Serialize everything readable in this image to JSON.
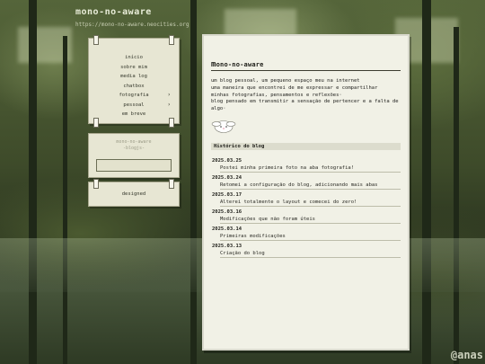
{
  "header": {
    "site_title": "mono-no-aware",
    "site_url": "https://mono-no-aware.neocities.org"
  },
  "watermark": "@anas",
  "sidebar": {
    "nav": [
      {
        "label": "início",
        "submenu": false
      },
      {
        "label": "sobre mim",
        "submenu": false
      },
      {
        "label": "media log",
        "submenu": false
      },
      {
        "label": "chatbox",
        "submenu": false
      },
      {
        "label": "fotografia",
        "submenu": true
      },
      {
        "label": "pessoal",
        "submenu": true
      },
      {
        "label": "em breve",
        "submenu": false
      }
    ],
    "blinkie_line1": "mono-no-aware",
    "blinkie_line2": "-blogjs-",
    "designed_label": "designed"
  },
  "main": {
    "title_initial": "m",
    "title_rest": "ono-no-aware",
    "intro_lines": [
      "um blog pessoal, um pequeno espaço meu na internet",
      "uma maneira que encontrei de me expressar e compartilhar",
      "minhas fotografias, pensamentos e reflexões·",
      "blog pensado em transmitir a sensação de pertencer e a falta de",
      "algo·"
    ],
    "history_title": "Histórico do blog",
    "history": [
      {
        "date": "2025.03.25",
        "text": "Postei minha primeira foto na aba fotografia!"
      },
      {
        "date": "2025.03.24",
        "text": "Retomei a configuração do blog, adicionando mais abas"
      },
      {
        "date": "2025.03.17",
        "text": "Alterei totalmente o layout e comecei do zero!"
      },
      {
        "date": "2025.03.16",
        "text": "Modificações que não foram úteis"
      },
      {
        "date": "2025.03.14",
        "text": "Primeiras modificações"
      },
      {
        "date": "2025.03.13",
        "text": "Criação do blog"
      }
    ]
  },
  "colors": {
    "panel_bg": "#f1f1e6",
    "card_bg": "#e7e6d3",
    "forest_dark": "#2f3a24"
  }
}
